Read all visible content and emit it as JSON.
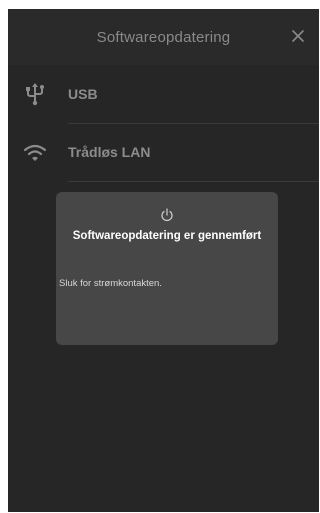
{
  "header": {
    "title": "Softwareopdatering",
    "close_icon": "close-icon"
  },
  "menu": {
    "items": [
      {
        "label": "USB",
        "icon": "usb-icon"
      },
      {
        "label": "Trådløs LAN",
        "icon": "wifi-icon"
      }
    ]
  },
  "dialog": {
    "icon": "power-icon",
    "title": "Softwareopdatering er gennemført",
    "message": "Sluk for strømkontakten."
  },
  "colors": {
    "background": "#262626",
    "dialog": "#474747",
    "muted_text": "#8c8c8c"
  }
}
